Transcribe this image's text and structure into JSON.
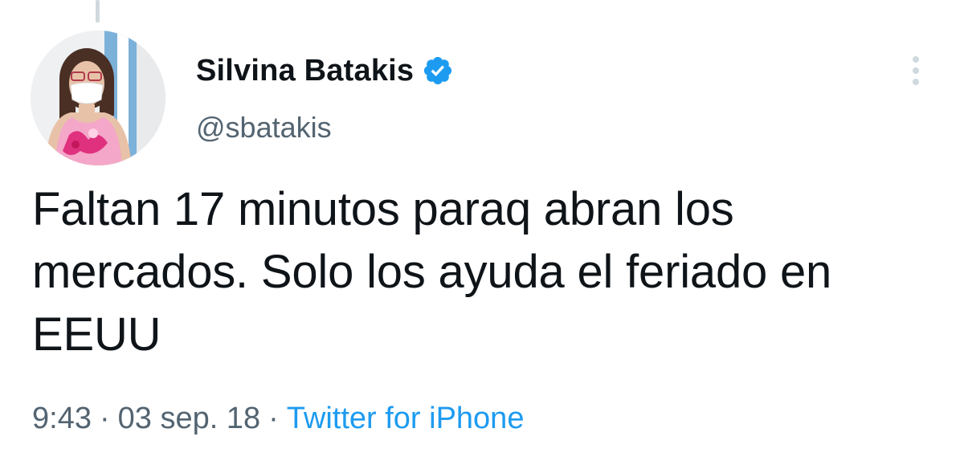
{
  "author": {
    "display_name": "Silvina Batakis",
    "handle": "@sbatakis",
    "verified": true,
    "verified_icon": "verified-badge-icon",
    "verified_color": "#1d9bf0"
  },
  "tweet": {
    "text": "Faltan 17 minutos paraq abran los mercados. Solo los ayuda el feriado en EEUU"
  },
  "meta": {
    "time": "9:43",
    "separator": "·",
    "date": "03 sep. 18",
    "source": "Twitter for iPhone"
  },
  "icons": {
    "more": "more-options-icon"
  },
  "colors": {
    "text": "#0f1419",
    "secondary": "#536471",
    "link": "#1d9bf0"
  }
}
